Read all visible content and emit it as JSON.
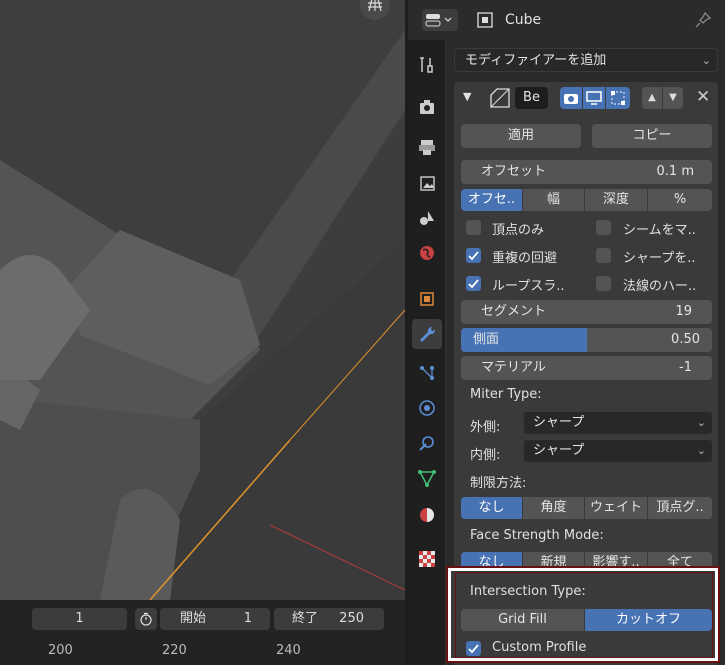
{
  "viewport": {
    "grid_icon": "grid-icon"
  },
  "timeline": {
    "current_frame": "1",
    "start_label": "開始",
    "start_value": "1",
    "end_label": "終了",
    "end_value": "250",
    "frame_marks": [
      "200",
      "220",
      "240"
    ]
  },
  "header": {
    "object_name": "Cube"
  },
  "modifiers": {
    "add_label": "モディファイアーを追加",
    "name_value": "Be",
    "apply_label": "適用",
    "copy_label": "コピー",
    "offset": {
      "label": "オフセット",
      "value": "0.1 m"
    },
    "width_types": [
      "オフセ..",
      "幅",
      "深度",
      "%"
    ],
    "checks": {
      "vertex_only": "頂点のみ",
      "seam": "シームをマ..",
      "clamp": "重複の回避",
      "sharp": "シャープを..",
      "loop_slide": "ループスラ..",
      "harden_normals": "法線のハー.."
    },
    "segments": {
      "label": "セグメント",
      "value": "19"
    },
    "profile": {
      "label": "側面",
      "value": "0.50",
      "fraction": 0.5
    },
    "material": {
      "label": "マテリアル",
      "value": "-1"
    },
    "miter_type_label": "Miter Type:",
    "outer_label": "外側:",
    "outer_value": "シャープ",
    "inner_label": "内側:",
    "inner_value": "シャープ",
    "limit_label": "制限方法:",
    "limit_options": [
      "なし",
      "角度",
      "ウェイト",
      "頂点グ.."
    ],
    "face_strength_label": "Face Strength Mode:",
    "face_strength_options": [
      "なし",
      "新規",
      "影響す..",
      "全て"
    ],
    "intersection_label": "Intersection Type:",
    "intersection_options": [
      "Grid Fill",
      "カットオフ"
    ],
    "custom_profile_label": "Custom Profile"
  }
}
